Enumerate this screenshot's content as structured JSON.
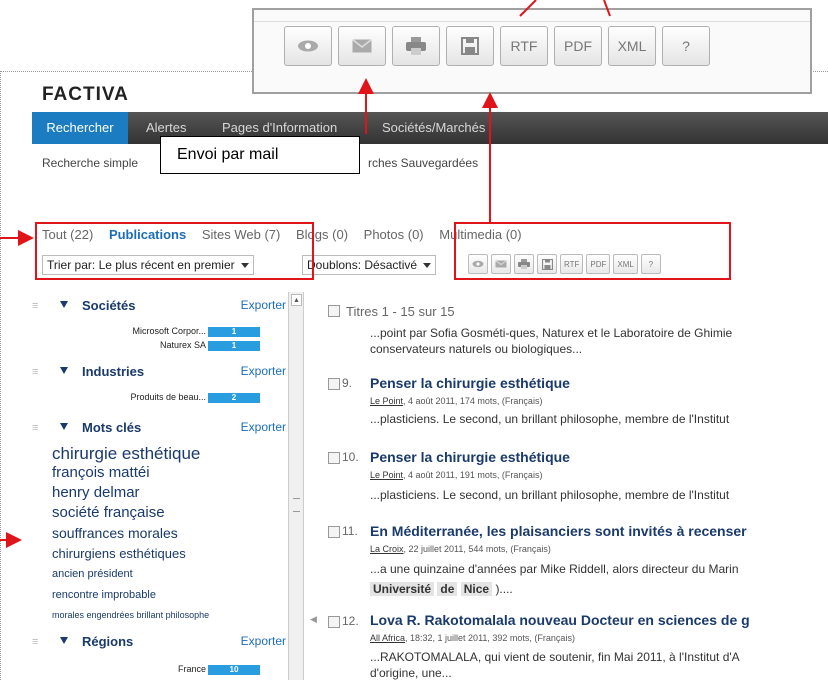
{
  "logo": "FACTIVA",
  "nav": {
    "search": "Rechercher",
    "alerts": "Alertes",
    "pages": "Pages d'Information",
    "companies": "Sociétés/Marchés"
  },
  "subnav": {
    "simple": "Recherche simple",
    "saved": "rches Sauvegardées"
  },
  "callout": "Envoi par mail",
  "tabs": [
    {
      "label": "Tout (22)"
    },
    {
      "label": "Publications"
    },
    {
      "label": "Sites Web (7)"
    },
    {
      "label": "Blogs (0)"
    },
    {
      "label": "Photos (0)"
    },
    {
      "label": "Multimedia (0)"
    }
  ],
  "sort": "Trier par: Le plus récent en premier",
  "duplicates": "Doublons: Désactivé",
  "toolbar": {
    "view_icon": "eye-icon",
    "mail_icon": "mail-icon",
    "print_icon": "print-icon",
    "save_icon": "save-icon",
    "rtf": "RTF",
    "pdf": "PDF",
    "xml": "XML",
    "help": "?"
  },
  "sidebar": {
    "companies": {
      "title": "Sociétés",
      "export": "Exporter",
      "items": [
        {
          "label": "Microsoft Corpor...",
          "count": "1"
        },
        {
          "label": "Naturex SA",
          "count": "1"
        }
      ]
    },
    "industries": {
      "title": "Industries",
      "export": "Exporter",
      "items": [
        {
          "label": "Produits de beau...",
          "count": "2"
        }
      ]
    },
    "keywords": {
      "title": "Mots clés",
      "export": "Exporter",
      "items": [
        "chirurgie esthétique",
        "françois mattéi",
        "henry delmar",
        "société française",
        "souffrances morales",
        "chirurgiens esthétiques",
        "ancien président",
        "rencontre improbable",
        "morales engendrées  brillant philosophe"
      ]
    },
    "regions": {
      "title": "Régions",
      "export": "Exporter",
      "items": [
        {
          "label": "France",
          "count": "10"
        }
      ]
    }
  },
  "results": {
    "header": "Titres 1 - 15 sur 15",
    "intro_snippet_1": "...point par Sofia Gosméti-ques, Naturex et le Laboratoire de Ghimie",
    "intro_snippet_2": "conservateurs naturels ou biologiques...",
    "items": [
      {
        "num": "9.",
        "title": "Penser la chirurgie esthétique",
        "source": "Le Point",
        "meta": ", 4 août 2011, 174 mots, (Français)",
        "snippet": "...plasticiens. Le second, un brillant philosophe, membre de l'Institut"
      },
      {
        "num": "10.",
        "title": "Penser la chirurgie esthétique",
        "source": "Le Point",
        "meta": ", 4 août 2011, 191 mots, (Français)",
        "snippet": "...plasticiens. Le second, un brillant philosophe, membre de l'Institut"
      },
      {
        "num": "11.",
        "title": "En Méditerranée, les plaisanciers sont invités à recenser",
        "source": "La Croix",
        "meta": ", 22 juillet 2011, 544 mots, (Français)",
        "snippet": "...a une quinzaine d'années par Mike Riddell, alors directeur du Marin",
        "snippet2_a": "Université",
        "snippet2_b": "de",
        "snippet2_c": "Nice",
        "snippet2_d": ")...."
      },
      {
        "num": "12.",
        "title": "Lova R. Rakotomalala nouveau Docteur en sciences de g",
        "source": "All Africa",
        "meta": ", 18:32, 1 juillet 2011, 392 mots, (Français)",
        "snippet": "...RAKOTOMALALA, qui vient de soutenir, fin Mai 2011, à l'Institut d'A",
        "snippet2": "d'origine, une..."
      }
    ]
  },
  "colors": {
    "annotation_red": "#e0151a",
    "nav_active": "#1b7cc1",
    "link_blue": "#1b6db8",
    "bar_blue": "#2a9de0"
  }
}
